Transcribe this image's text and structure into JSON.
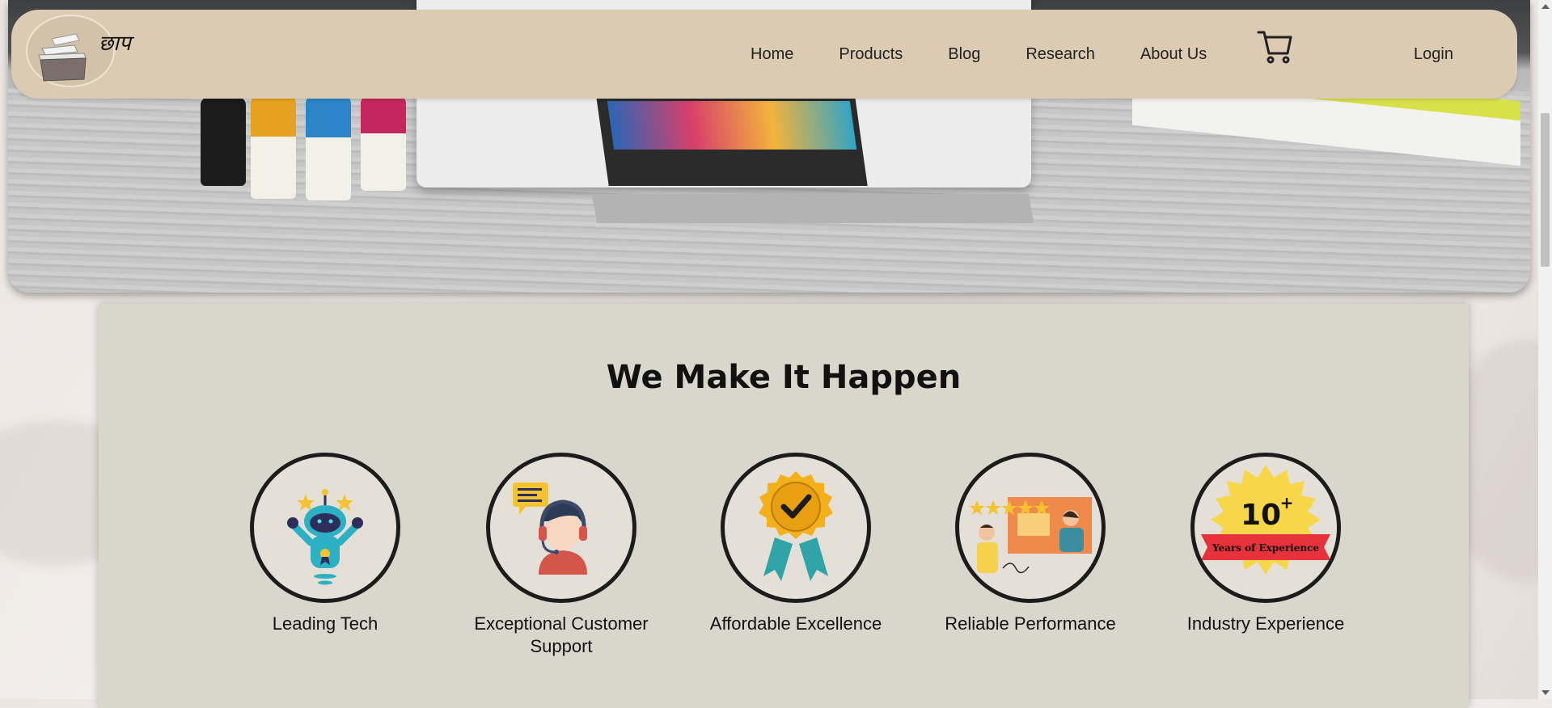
{
  "navbar": {
    "logo_text": "छाप",
    "links": [
      "Home",
      "Products",
      "Blog",
      "Research",
      "About Us"
    ],
    "login_label": "Login",
    "cart_icon": "shopping-cart-icon",
    "background": "#dccbb3"
  },
  "hero": {
    "description_icon": "printer-hero-image"
  },
  "section": {
    "title": "We Make It Happen",
    "background": "#d9d6cc",
    "features": [
      {
        "label": "Leading Tech",
        "icon": "robot-icon"
      },
      {
        "label": "Exceptional Customer Support",
        "icon": "support-headset-icon"
      },
      {
        "label": "Affordable Excellence",
        "icon": "best-price-badge-icon"
      },
      {
        "label": "Reliable Performance",
        "icon": "rating-review-icon"
      },
      {
        "label": "Industry Experience",
        "icon": "years-experience-badge-icon",
        "badge_number": "10",
        "badge_sup": "+",
        "badge_text": "Years of Experience"
      }
    ]
  }
}
